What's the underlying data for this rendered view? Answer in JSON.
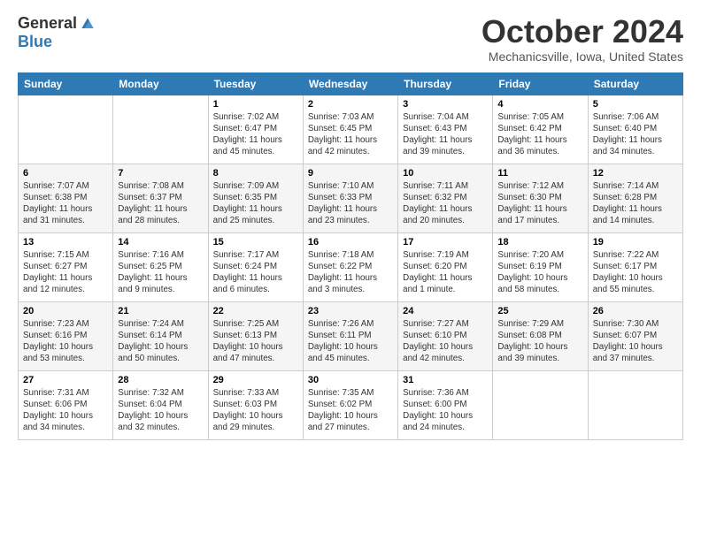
{
  "header": {
    "logo_general": "General",
    "logo_blue": "Blue",
    "title": "October 2024",
    "location": "Mechanicsville, Iowa, United States"
  },
  "weekdays": [
    "Sunday",
    "Monday",
    "Tuesday",
    "Wednesday",
    "Thursday",
    "Friday",
    "Saturday"
  ],
  "weeks": [
    [
      {
        "day": "",
        "sunrise": "",
        "sunset": "",
        "daylight": ""
      },
      {
        "day": "",
        "sunrise": "",
        "sunset": "",
        "daylight": ""
      },
      {
        "day": "1",
        "sunrise": "Sunrise: 7:02 AM",
        "sunset": "Sunset: 6:47 PM",
        "daylight": "Daylight: 11 hours and 45 minutes."
      },
      {
        "day": "2",
        "sunrise": "Sunrise: 7:03 AM",
        "sunset": "Sunset: 6:45 PM",
        "daylight": "Daylight: 11 hours and 42 minutes."
      },
      {
        "day": "3",
        "sunrise": "Sunrise: 7:04 AM",
        "sunset": "Sunset: 6:43 PM",
        "daylight": "Daylight: 11 hours and 39 minutes."
      },
      {
        "day": "4",
        "sunrise": "Sunrise: 7:05 AM",
        "sunset": "Sunset: 6:42 PM",
        "daylight": "Daylight: 11 hours and 36 minutes."
      },
      {
        "day": "5",
        "sunrise": "Sunrise: 7:06 AM",
        "sunset": "Sunset: 6:40 PM",
        "daylight": "Daylight: 11 hours and 34 minutes."
      }
    ],
    [
      {
        "day": "6",
        "sunrise": "Sunrise: 7:07 AM",
        "sunset": "Sunset: 6:38 PM",
        "daylight": "Daylight: 11 hours and 31 minutes."
      },
      {
        "day": "7",
        "sunrise": "Sunrise: 7:08 AM",
        "sunset": "Sunset: 6:37 PM",
        "daylight": "Daylight: 11 hours and 28 minutes."
      },
      {
        "day": "8",
        "sunrise": "Sunrise: 7:09 AM",
        "sunset": "Sunset: 6:35 PM",
        "daylight": "Daylight: 11 hours and 25 minutes."
      },
      {
        "day": "9",
        "sunrise": "Sunrise: 7:10 AM",
        "sunset": "Sunset: 6:33 PM",
        "daylight": "Daylight: 11 hours and 23 minutes."
      },
      {
        "day": "10",
        "sunrise": "Sunrise: 7:11 AM",
        "sunset": "Sunset: 6:32 PM",
        "daylight": "Daylight: 11 hours and 20 minutes."
      },
      {
        "day": "11",
        "sunrise": "Sunrise: 7:12 AM",
        "sunset": "Sunset: 6:30 PM",
        "daylight": "Daylight: 11 hours and 17 minutes."
      },
      {
        "day": "12",
        "sunrise": "Sunrise: 7:14 AM",
        "sunset": "Sunset: 6:28 PM",
        "daylight": "Daylight: 11 hours and 14 minutes."
      }
    ],
    [
      {
        "day": "13",
        "sunrise": "Sunrise: 7:15 AM",
        "sunset": "Sunset: 6:27 PM",
        "daylight": "Daylight: 11 hours and 12 minutes."
      },
      {
        "day": "14",
        "sunrise": "Sunrise: 7:16 AM",
        "sunset": "Sunset: 6:25 PM",
        "daylight": "Daylight: 11 hours and 9 minutes."
      },
      {
        "day": "15",
        "sunrise": "Sunrise: 7:17 AM",
        "sunset": "Sunset: 6:24 PM",
        "daylight": "Daylight: 11 hours and 6 minutes."
      },
      {
        "day": "16",
        "sunrise": "Sunrise: 7:18 AM",
        "sunset": "Sunset: 6:22 PM",
        "daylight": "Daylight: 11 hours and 3 minutes."
      },
      {
        "day": "17",
        "sunrise": "Sunrise: 7:19 AM",
        "sunset": "Sunset: 6:20 PM",
        "daylight": "Daylight: 11 hours and 1 minute."
      },
      {
        "day": "18",
        "sunrise": "Sunrise: 7:20 AM",
        "sunset": "Sunset: 6:19 PM",
        "daylight": "Daylight: 10 hours and 58 minutes."
      },
      {
        "day": "19",
        "sunrise": "Sunrise: 7:22 AM",
        "sunset": "Sunset: 6:17 PM",
        "daylight": "Daylight: 10 hours and 55 minutes."
      }
    ],
    [
      {
        "day": "20",
        "sunrise": "Sunrise: 7:23 AM",
        "sunset": "Sunset: 6:16 PM",
        "daylight": "Daylight: 10 hours and 53 minutes."
      },
      {
        "day": "21",
        "sunrise": "Sunrise: 7:24 AM",
        "sunset": "Sunset: 6:14 PM",
        "daylight": "Daylight: 10 hours and 50 minutes."
      },
      {
        "day": "22",
        "sunrise": "Sunrise: 7:25 AM",
        "sunset": "Sunset: 6:13 PM",
        "daylight": "Daylight: 10 hours and 47 minutes."
      },
      {
        "day": "23",
        "sunrise": "Sunrise: 7:26 AM",
        "sunset": "Sunset: 6:11 PM",
        "daylight": "Daylight: 10 hours and 45 minutes."
      },
      {
        "day": "24",
        "sunrise": "Sunrise: 7:27 AM",
        "sunset": "Sunset: 6:10 PM",
        "daylight": "Daylight: 10 hours and 42 minutes."
      },
      {
        "day": "25",
        "sunrise": "Sunrise: 7:29 AM",
        "sunset": "Sunset: 6:08 PM",
        "daylight": "Daylight: 10 hours and 39 minutes."
      },
      {
        "day": "26",
        "sunrise": "Sunrise: 7:30 AM",
        "sunset": "Sunset: 6:07 PM",
        "daylight": "Daylight: 10 hours and 37 minutes."
      }
    ],
    [
      {
        "day": "27",
        "sunrise": "Sunrise: 7:31 AM",
        "sunset": "Sunset: 6:06 PM",
        "daylight": "Daylight: 10 hours and 34 minutes."
      },
      {
        "day": "28",
        "sunrise": "Sunrise: 7:32 AM",
        "sunset": "Sunset: 6:04 PM",
        "daylight": "Daylight: 10 hours and 32 minutes."
      },
      {
        "day": "29",
        "sunrise": "Sunrise: 7:33 AM",
        "sunset": "Sunset: 6:03 PM",
        "daylight": "Daylight: 10 hours and 29 minutes."
      },
      {
        "day": "30",
        "sunrise": "Sunrise: 7:35 AM",
        "sunset": "Sunset: 6:02 PM",
        "daylight": "Daylight: 10 hours and 27 minutes."
      },
      {
        "day": "31",
        "sunrise": "Sunrise: 7:36 AM",
        "sunset": "Sunset: 6:00 PM",
        "daylight": "Daylight: 10 hours and 24 minutes."
      },
      {
        "day": "",
        "sunrise": "",
        "sunset": "",
        "daylight": ""
      },
      {
        "day": "",
        "sunrise": "",
        "sunset": "",
        "daylight": ""
      }
    ]
  ]
}
